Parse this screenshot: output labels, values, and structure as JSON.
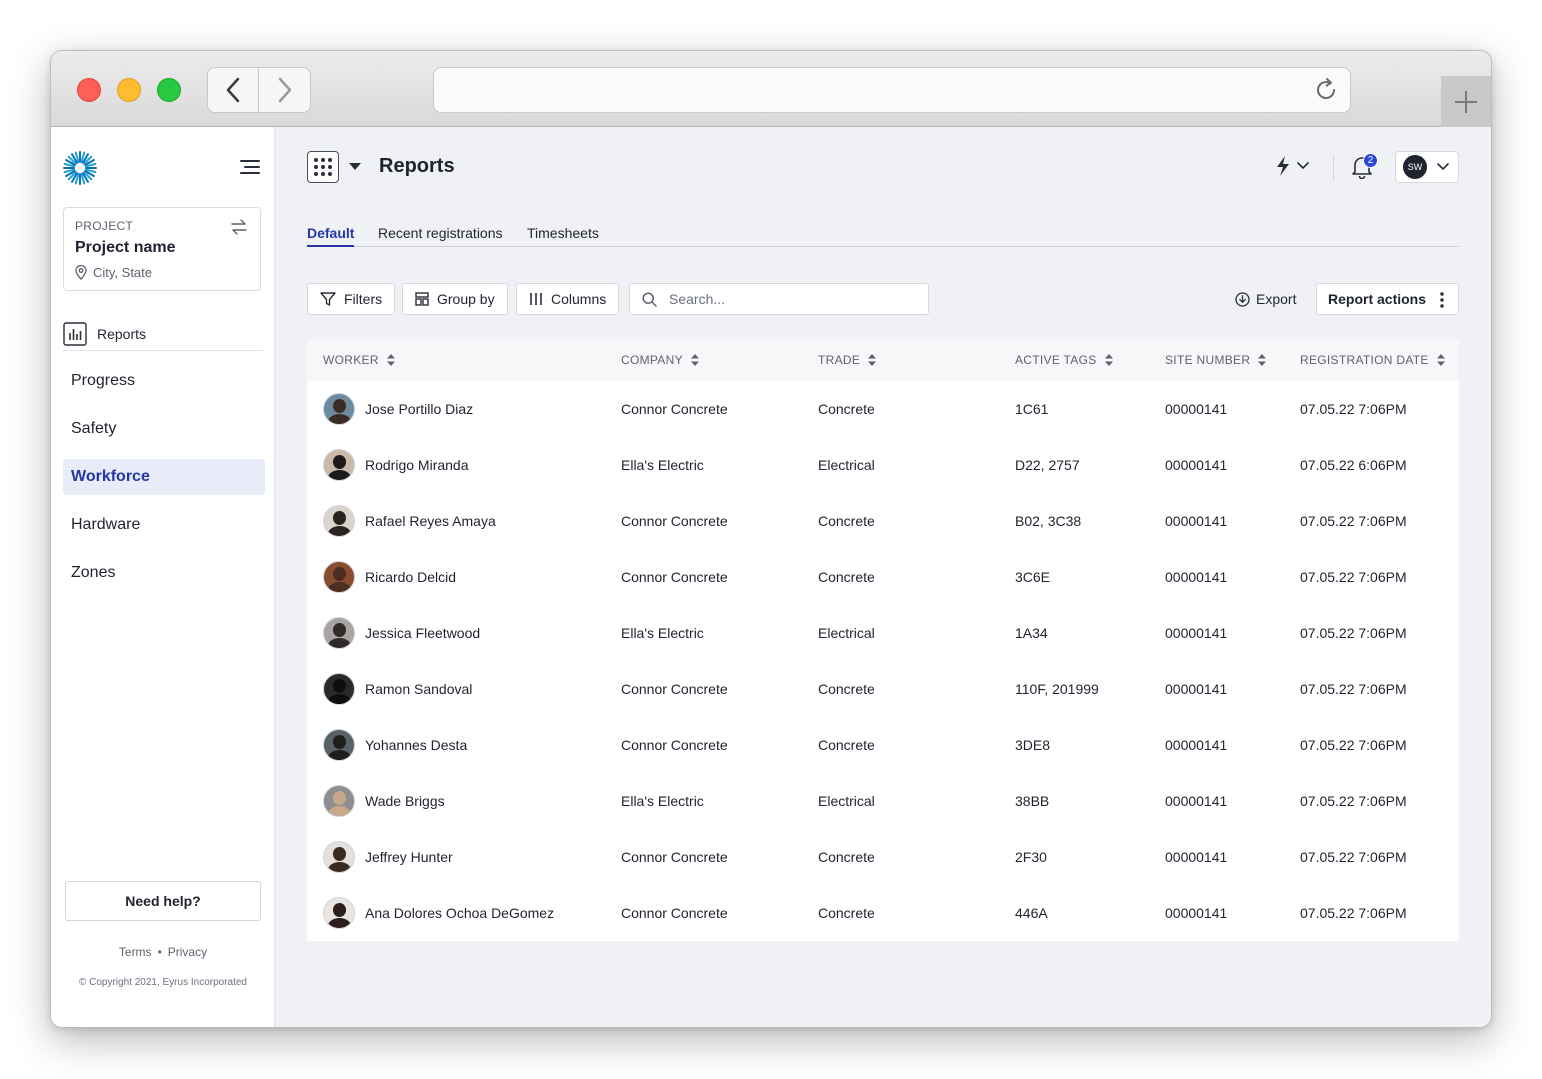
{
  "sidebar": {
    "project": {
      "label": "PROJECT",
      "name": "Project name",
      "location": "City, State"
    },
    "reports_label": "Reports",
    "nav": [
      {
        "label": "Progress",
        "active": false
      },
      {
        "label": "Safety",
        "active": false
      },
      {
        "label": "Workforce",
        "active": true
      },
      {
        "label": "Hardware",
        "active": false
      },
      {
        "label": "Zones",
        "active": false
      }
    ],
    "help_label": "Need help?",
    "terms_label": "Terms",
    "privacy_label": "Privacy",
    "copyright": "© Copyright 2021, Eyrus Incorporated"
  },
  "header": {
    "title": "Reports",
    "notification_count": "2",
    "user_initials": "SW"
  },
  "tabs": [
    "Default",
    "Recent registrations",
    "Timesheets"
  ],
  "toolbar": {
    "filters_label": "Filters",
    "groupby_label": "Group by",
    "columns_label": "Columns",
    "search_placeholder": "Search...",
    "export_label": "Export",
    "report_actions_label": "Report actions"
  },
  "table": {
    "columns": [
      "WORKER",
      "COMPANY",
      "TRADE",
      "ACTIVE TAGS",
      "SITE NUMBER",
      "REGISTRATION DATE"
    ],
    "rows": [
      {
        "worker": "Jose Portillo Diaz",
        "company": "Connor Concrete",
        "trade": "Concrete",
        "tags": "1C61",
        "site": "00000141",
        "date": "07.05.22 7:06PM"
      },
      {
        "worker": "Rodrigo Miranda",
        "company": "Ella's Electric",
        "trade": "Electrical",
        "tags": "D22, 2757",
        "site": "00000141",
        "date": "07.05.22 6:06PM"
      },
      {
        "worker": "Rafael Reyes Amaya",
        "company": "Connor Concrete",
        "trade": "Concrete",
        "tags": "B02, 3C38",
        "site": "00000141",
        "date": "07.05.22 7:06PM"
      },
      {
        "worker": "Ricardo Delcid",
        "company": "Connor Concrete",
        "trade": "Concrete",
        "tags": "3C6E",
        "site": "00000141",
        "date": "07.05.22 7:06PM"
      },
      {
        "worker": "Jessica Fleetwood",
        "company": "Ella's Electric",
        "trade": "Electrical",
        "tags": "1A34",
        "site": "00000141",
        "date": "07.05.22 7:06PM"
      },
      {
        "worker": "Ramon Sandoval",
        "company": "Connor Concrete",
        "trade": "Concrete",
        "tags": "110F, 201999",
        "site": "00000141",
        "date": "07.05.22 7:06PM"
      },
      {
        "worker": "Yohannes Desta",
        "company": "Connor Concrete",
        "trade": "Concrete",
        "tags": "3DE8",
        "site": "00000141",
        "date": "07.05.22 7:06PM"
      },
      {
        "worker": "Wade Briggs",
        "company": "Ella's Electric",
        "trade": "Electrical",
        "tags": "38BB",
        "site": "00000141",
        "date": "07.05.22 7:06PM"
      },
      {
        "worker": "Jeffrey Hunter",
        "company": "Connor Concrete",
        "trade": "Concrete",
        "tags": "2F30",
        "site": "00000141",
        "date": "07.05.22 7:06PM"
      },
      {
        "worker": "Ana Dolores Ochoa DeGomez",
        "company": "Connor Concrete",
        "trade": "Concrete",
        "tags": "446A",
        "site": "00000141",
        "date": "07.05.22 7:06PM"
      }
    ]
  },
  "colors": {
    "accent": "#2537a8",
    "badge": "#2b47d6",
    "active_nav_bg": "#e8ecf8",
    "main_bg": "#f0f1f5",
    "avatar_palette": [
      [
        "#3a2c24",
        "#6d8a9e"
      ],
      [
        "#1c1a1a",
        "#c9b9a8"
      ],
      [
        "#2a2320",
        "#d9d4cc"
      ],
      [
        "#4a2f22",
        "#8a4c2e"
      ],
      [
        "#2f2b2b",
        "#a9a4a1"
      ],
      [
        "#0e0e0e",
        "#2a2a2a"
      ],
      [
        "#1f1e1c",
        "#586165"
      ],
      [
        "#c7a98a",
        "#8e8e92"
      ],
      [
        "#3b2a22",
        "#e4e1dc"
      ],
      [
        "#2a1f1a",
        "#e9e6e2"
      ]
    ]
  },
  "icons": {
    "logo": "eyrus-burst-logo",
    "menu": "hamburger-icon",
    "swap": "swap-arrows-icon",
    "location": "map-pin-icon",
    "reports": "bar-chart-icon",
    "apps": "grid-dots-icon",
    "bolt": "lightning-icon",
    "bell": "bell-icon",
    "filter": "funnel-icon",
    "groupby": "group-icon",
    "columns": "columns-icon",
    "search": "search-icon",
    "export": "download-circle-icon",
    "kebab": "vertical-dots-icon",
    "sort": "sort-arrows-icon"
  }
}
